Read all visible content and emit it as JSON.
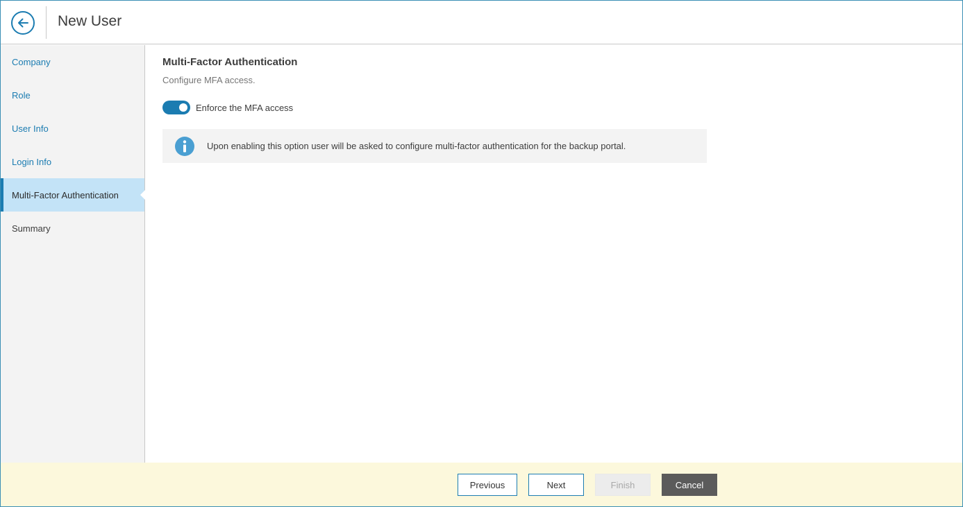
{
  "window": {
    "title": "New User"
  },
  "header": {
    "back_icon": "arrow-left-icon"
  },
  "sidebar": {
    "items": [
      {
        "label": "Company",
        "state": "visited"
      },
      {
        "label": "Role",
        "state": "visited"
      },
      {
        "label": "User Info",
        "state": "visited"
      },
      {
        "label": "Login Info",
        "state": "visited"
      },
      {
        "label": "Multi-Factor Authentication",
        "state": "active"
      },
      {
        "label": "Summary",
        "state": "upcoming"
      }
    ]
  },
  "main": {
    "title": "Multi-Factor Authentication",
    "subtitle": "Configure MFA access.",
    "toggle": {
      "label": "Enforce the MFA access",
      "checked": true
    },
    "info": {
      "icon": "info-icon",
      "text": "Upon enabling this option user will be asked to configure multi-factor authentication for the backup portal."
    }
  },
  "footer": {
    "previous_label": "Previous",
    "next_label": "Next",
    "finish_label": "Finish",
    "cancel_label": "Cancel"
  },
  "colors": {
    "accent": "#1b7cb1",
    "active_nav_bg": "#c3e3f7",
    "footer_bg": "#fcf8dc",
    "info_icon": "#4a9fd2",
    "cancel_bg": "#5b5b5b"
  }
}
